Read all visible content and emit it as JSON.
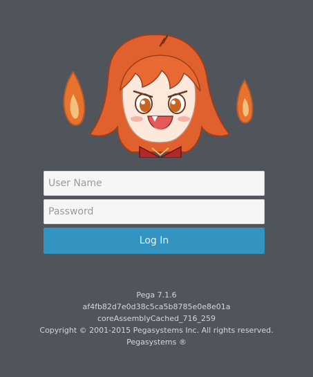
{
  "login": {
    "username_placeholder": "User Name",
    "password_placeholder": "Password",
    "button_label": "Log In"
  },
  "footer": {
    "version": "Pega 7.1.6",
    "build_hash": "af4fb82d7e0d38c5ca5b8785e0e8e01a",
    "assembly": "coreAssemblyCached_716_259",
    "copyright": "Copyright © 2001-2015 Pegasystems Inc. All rights reserved.",
    "company": "Pegasystems ®"
  },
  "colors": {
    "background": "#50555c",
    "button": "#3393c1",
    "hair": "#e0612d",
    "flame_outer": "#e8732f",
    "flame_inner": "#f6c07c"
  },
  "icons": {
    "mascot": "flame-girl-mascot"
  }
}
